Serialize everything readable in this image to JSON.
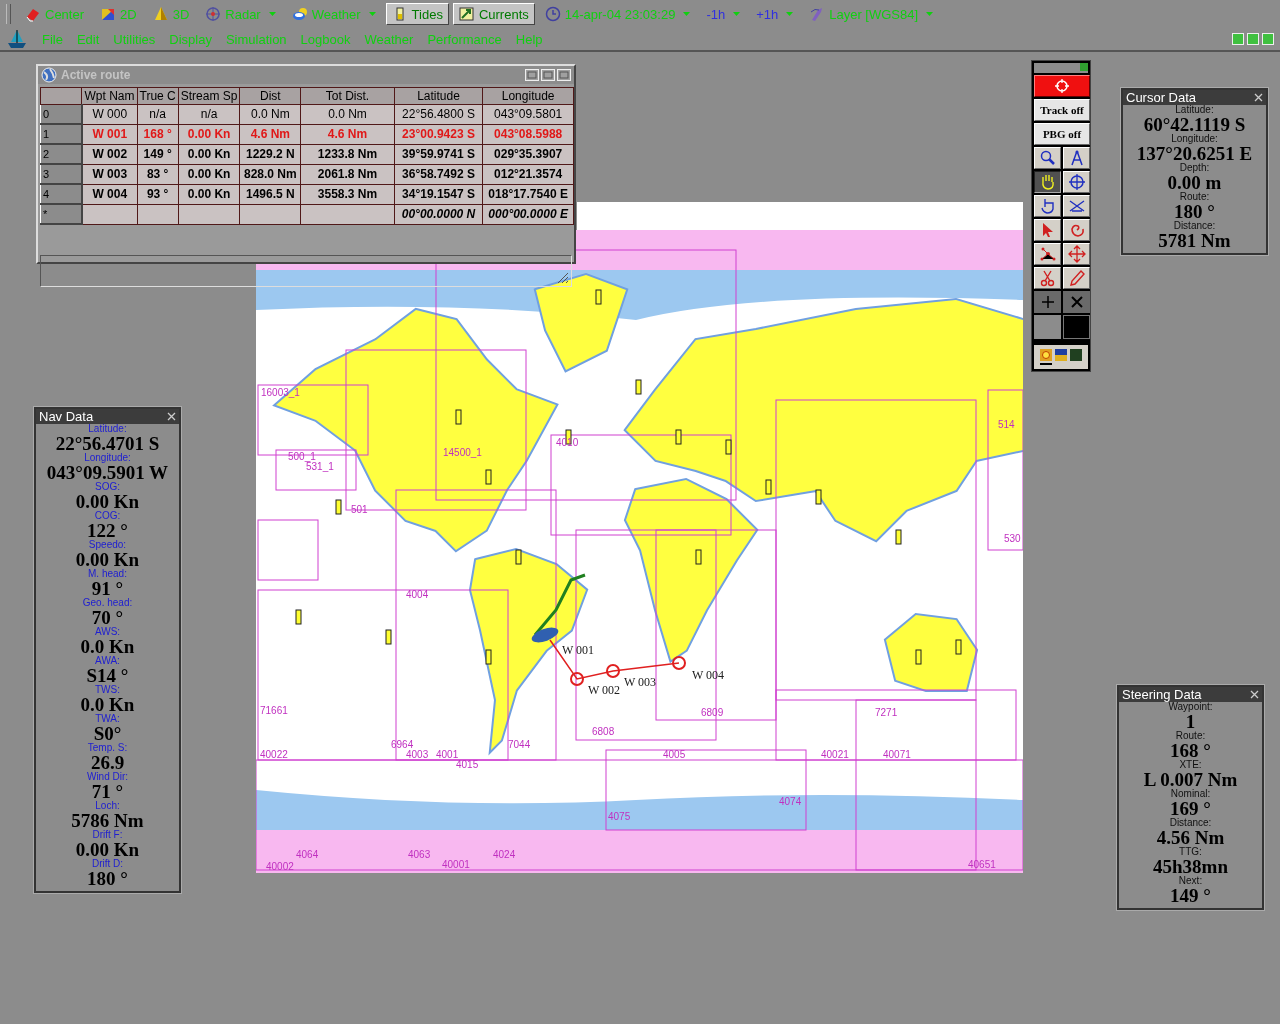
{
  "toolbar": {
    "items": [
      {
        "label": "Center",
        "kind": "button",
        "pressed": false
      },
      {
        "label": "2D",
        "kind": "button",
        "pressed": false
      },
      {
        "label": "3D",
        "kind": "button",
        "pressed": false
      },
      {
        "label": "Radar",
        "kind": "dropdown",
        "pressed": false
      },
      {
        "label": "Weather",
        "kind": "dropdown",
        "pressed": false
      },
      {
        "label": "Tides",
        "kind": "button",
        "pressed": true
      },
      {
        "label": "Currents",
        "kind": "button",
        "pressed": true
      },
      {
        "label": "14-apr-04 23:03:29",
        "kind": "dropdown",
        "pressed": false
      },
      {
        "label": "-1h",
        "kind": "time-step",
        "pressed": false
      },
      {
        "label": "+1h",
        "kind": "time-step",
        "pressed": false
      },
      {
        "label": "Layer [WGS84]",
        "kind": "dropdown",
        "pressed": false
      }
    ]
  },
  "menu": [
    "File",
    "Edit",
    "Utilities",
    "Display",
    "Simulation",
    "Logbook",
    "Weather",
    "Performance",
    "Help"
  ],
  "route_window": {
    "title": "Active route",
    "columns": [
      "Wpt Nam",
      "True C",
      "Stream Sp",
      "Dist",
      "Tot Dist.",
      "Latitude",
      "Longitude"
    ],
    "rows": [
      {
        "index": "0",
        "kind": "passed",
        "cells": [
          "W 000",
          "n/a",
          "n/a",
          "0.0 Nm",
          "0.0 Nm",
          "22°56.4800 S",
          "043°09.5801"
        ]
      },
      {
        "index": "1",
        "kind": "active",
        "cells": [
          "W 001",
          "168 °",
          "0.00 Kn",
          "4.6 Nm",
          "4.6 Nm",
          "23°00.9423 S",
          "043°08.5988"
        ]
      },
      {
        "index": "2",
        "kind": "pending",
        "cells": [
          "W 002",
          "149 °",
          "0.00 Kn",
          "1229.2 N",
          "1233.8 Nm",
          "39°59.9741 S",
          "029°35.3907"
        ]
      },
      {
        "index": "3",
        "kind": "pending",
        "cells": [
          "W 003",
          "83 °",
          "0.00 Kn",
          "828.0 Nm",
          "2061.8 Nm",
          "36°58.7492 S",
          "012°21.3574"
        ]
      },
      {
        "index": "4",
        "kind": "pending",
        "cells": [
          "W 004",
          "93 °",
          "0.00 Kn",
          "1496.5 N",
          "3558.3 Nm",
          "34°19.1547 S",
          "018°17.7540 E"
        ]
      },
      {
        "index": "*",
        "kind": "new",
        "cells": [
          null,
          null,
          null,
          null,
          null,
          "00°00.0000 N",
          "000°00.0000 E"
        ]
      }
    ]
  },
  "palette": {
    "track_button": "Track off",
    "pbg_button": "PBG off",
    "tools": [
      {
        "selected": false
      },
      {
        "selected": false
      },
      {
        "selected": true
      },
      {
        "selected": false
      },
      {
        "selected": false
      },
      {
        "selected": false
      },
      {
        "selected": false
      },
      {
        "selected": false
      },
      {
        "selected": false
      },
      {
        "selected": false
      },
      {
        "selected": false
      },
      {
        "selected": false
      }
    ],
    "display_modes": [
      {
        "selected": true
      },
      {
        "selected": false
      },
      {
        "selected": false
      }
    ]
  },
  "panels": [
    {
      "kind": "cursor",
      "title": "Cursor Data",
      "fields": [
        {
          "label": "Latitude:",
          "value": "60°42.1119 S"
        },
        {
          "label": "Longitude:",
          "value": "137°20.6251 E"
        },
        {
          "label": "Depth:",
          "value": "0.00 m"
        },
        {
          "label": "Route:",
          "value": "180 °"
        },
        {
          "label": "Distance:",
          "value": "5781 Nm"
        }
      ]
    },
    {
      "kind": "navigation",
      "title": "Nav Data",
      "fields": [
        {
          "label": "Latitude:",
          "value": "22°56.4701 S"
        },
        {
          "label": "Longitude:",
          "value": "043°09.5901 W"
        },
        {
          "label": "SOG:",
          "value": "0.00 Kn"
        },
        {
          "label": "COG:",
          "value": "122 °"
        },
        {
          "label": "Speedo:",
          "value": "0.00 Kn"
        },
        {
          "label": "M. head:",
          "value": "91 °"
        },
        {
          "label": "Geo. head:",
          "value": "70 °"
        },
        {
          "label": "AWS:",
          "value": "0.0 Kn"
        },
        {
          "label": "AWA:",
          "value": "S14 °"
        },
        {
          "label": "TWS:",
          "value": "0.0 Kn"
        },
        {
          "label": "TWA:",
          "value": "S0°"
        },
        {
          "label": "Temp. S:",
          "value": "26.9"
        },
        {
          "label": "Wind Dir:",
          "value": "71 °"
        },
        {
          "label": "Loch:",
          "value": "5786 Nm"
        },
        {
          "label": "Drift F:",
          "value": "0.00 Kn"
        },
        {
          "label": "Drift D:",
          "value": "180 °"
        }
      ]
    },
    {
      "kind": "steering",
      "title": "Steering Data",
      "fields": [
        {
          "label": "Waypoint:",
          "value": "1"
        },
        {
          "label": "Route:",
          "value": "168 °"
        },
        {
          "label": "XTE:",
          "value": "L 0.007 Nm"
        },
        {
          "label": "Nominal:",
          "value": "169 °"
        },
        {
          "label": "Distance:",
          "value": "4.56 Nm"
        },
        {
          "label": "TTG:",
          "value": "45h38mn"
        },
        {
          "label": "Next:",
          "value": "149 °"
        }
      ]
    }
  ],
  "map": {
    "chart_labels": [
      "16003_1",
      "500_1",
      "531_1",
      "14500_1",
      "501",
      "4010",
      "4004",
      "71661",
      "6964",
      "4003",
      "4001",
      "4015",
      "7044",
      "40022",
      "6808",
      "6809",
      "4005",
      "4075",
      "40021",
      "40071",
      "4074",
      "7271",
      "4064",
      "40002",
      "4063",
      "40001",
      "4024",
      "40651",
      "514",
      "530"
    ],
    "waypoint_labels": [
      "W 001",
      "W 002",
      "W 003",
      "W 004"
    ]
  }
}
